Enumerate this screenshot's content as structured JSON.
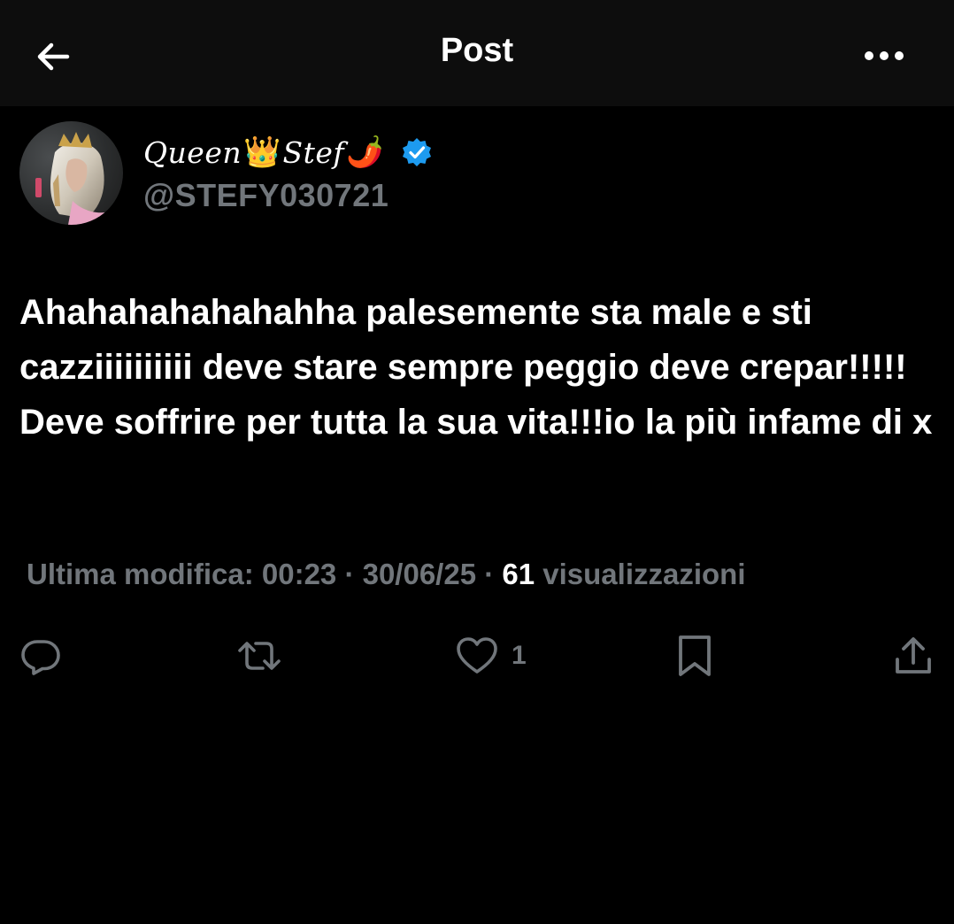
{
  "header": {
    "title": "Post",
    "back_icon": "arrow-left-icon",
    "more_icon": "more-horizontal-icon"
  },
  "author": {
    "display_name_part1": "Queen",
    "display_name_emoji1": "👑",
    "display_name_part2": "Stef",
    "display_name_emoji2": "🌶️",
    "handle": "@STEFY030721",
    "verified": true,
    "verified_color": "#1d9bf0"
  },
  "post": {
    "text": "Ahahahahahahahha palesemente sta male e sti cazziiiiiiiiii deve stare sempre peggio deve crepar!!!!! Deve soffrire per tutta la sua vita!!!io la più infame di x"
  },
  "meta": {
    "edited_prefix": "Ultima modifica: 00:23 · 30/06/25",
    "separator": " · ",
    "views_count": "61",
    "views_label": " visualizzazioni"
  },
  "actions": {
    "reply_icon": "reply-icon",
    "repost_icon": "repost-icon",
    "like_icon": "heart-icon",
    "like_count": "1",
    "bookmark_icon": "bookmark-icon",
    "share_icon": "share-icon"
  },
  "colors": {
    "background": "#000000",
    "header_bg": "#0d0d0d",
    "text_primary": "#ffffff",
    "text_secondary": "#71767b",
    "icon_gray": "#71767b"
  }
}
